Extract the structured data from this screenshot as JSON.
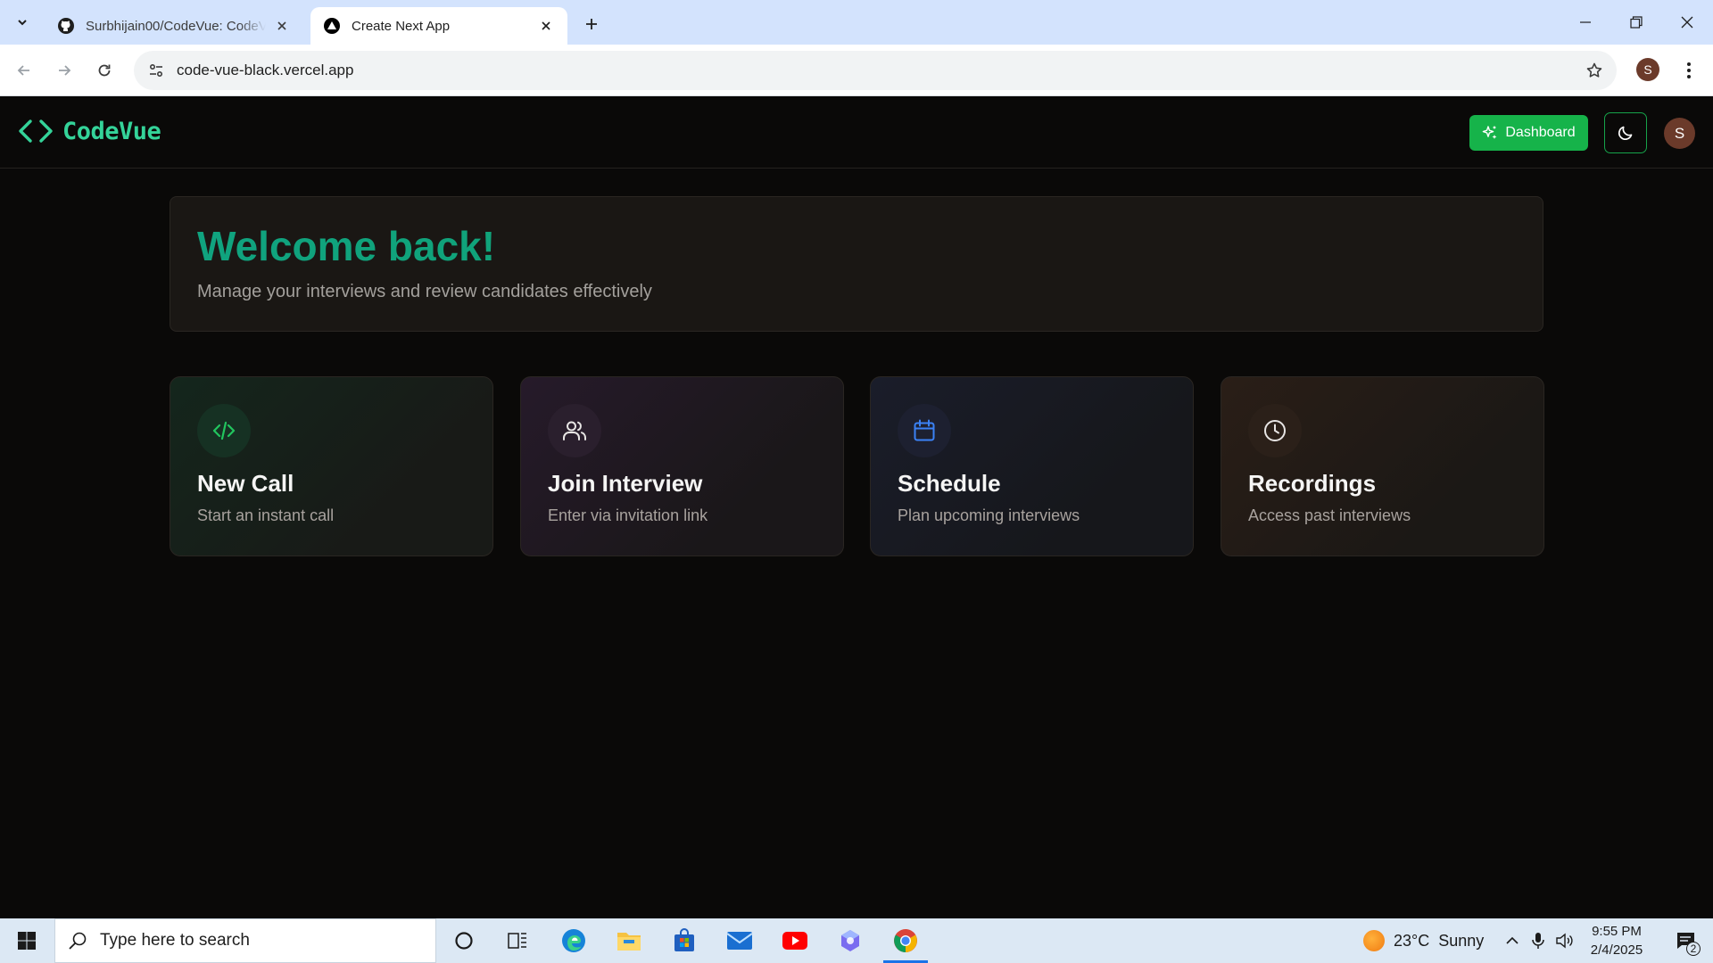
{
  "browser": {
    "tabs": [
      {
        "title": "Surbhijain00/CodeVue: CodeVue",
        "favicon": "github-icon",
        "active": false
      },
      {
        "title": "Create Next App",
        "favicon": "nextjs-icon",
        "active": true
      }
    ],
    "url": "code-vue-black.vercel.app",
    "profile_initial": "S"
  },
  "app": {
    "brand": "CodeVue",
    "brand_icon": "code-brackets-icon",
    "dashboard_label": "Dashboard",
    "theme_icon": "moon-icon",
    "avatar_initial": "S",
    "colors": {
      "accent": "#10a37f",
      "button": "#16b34a"
    },
    "welcome": {
      "title": "Welcome back!",
      "subtitle": "Manage your interviews and review candidates effectively"
    },
    "cards": [
      {
        "title": "New Call",
        "description": "Start an instant call",
        "icon": "code-icon",
        "color": "#22c55e"
      },
      {
        "title": "Join Interview",
        "description": "Enter via invitation link",
        "icon": "users-icon",
        "color": "#e7e5e4"
      },
      {
        "title": "Schedule",
        "description": "Plan upcoming interviews",
        "icon": "calendar-icon",
        "color": "#3b82f6"
      },
      {
        "title": "Recordings",
        "description": "Access past interviews",
        "icon": "clock-icon",
        "color": "#e7e5e4"
      }
    ]
  },
  "taskbar": {
    "search_placeholder": "Type here to search",
    "weather": {
      "temp": "23°C",
      "condition": "Sunny"
    },
    "time": "9:55 PM",
    "date": "2/4/2025",
    "notification_count": "2"
  }
}
